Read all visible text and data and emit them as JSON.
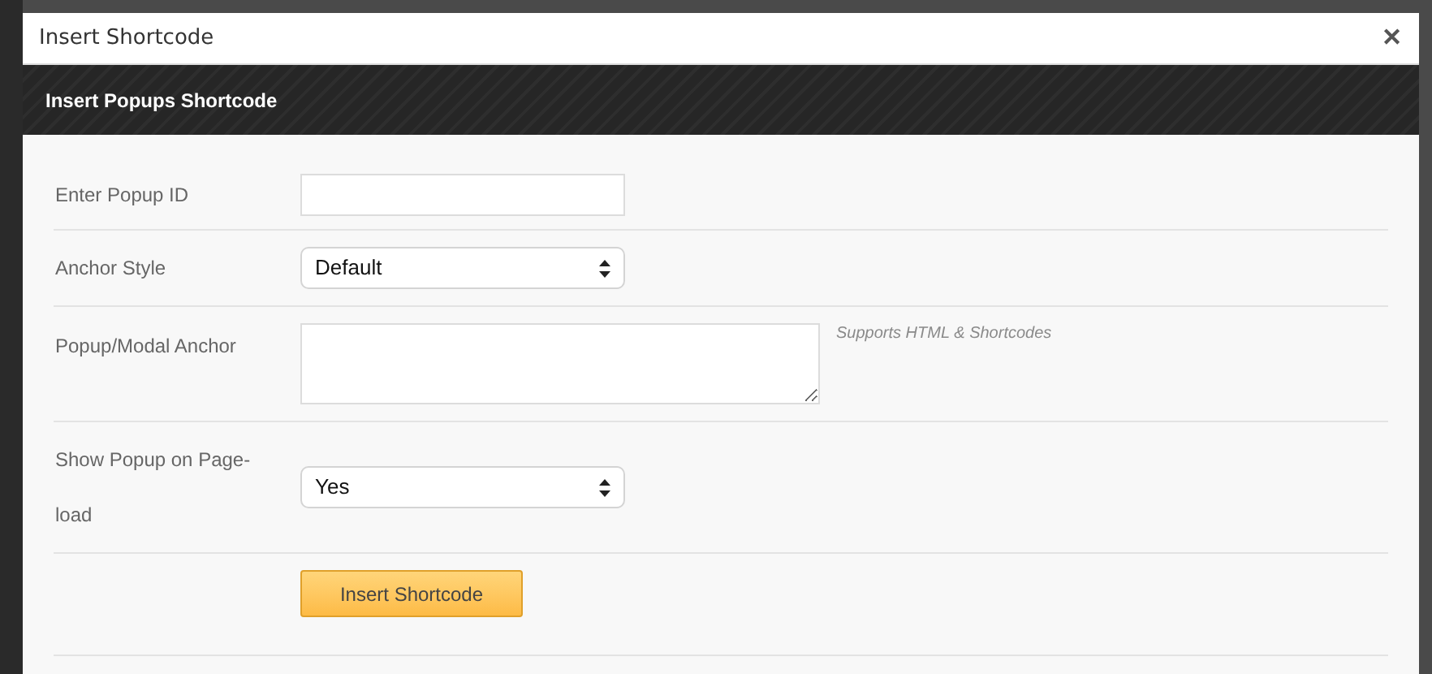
{
  "window": {
    "title": "Insert Shortcode",
    "close": "✕"
  },
  "header": {
    "title": "Insert Popups Shortcode"
  },
  "fields": [
    {
      "kind": "text",
      "label": "Enter Popup ID"
    },
    {
      "kind": "select",
      "label": "Anchor Style",
      "value": "Default"
    },
    {
      "kind": "textarea",
      "label": "Popup/Modal Anchor",
      "note": "Supports HTML & Shortcodes"
    },
    {
      "kind": "select",
      "label": "Show Popup on Page-load",
      "value": "Yes"
    }
  ],
  "submit": "Insert Shortcode"
}
